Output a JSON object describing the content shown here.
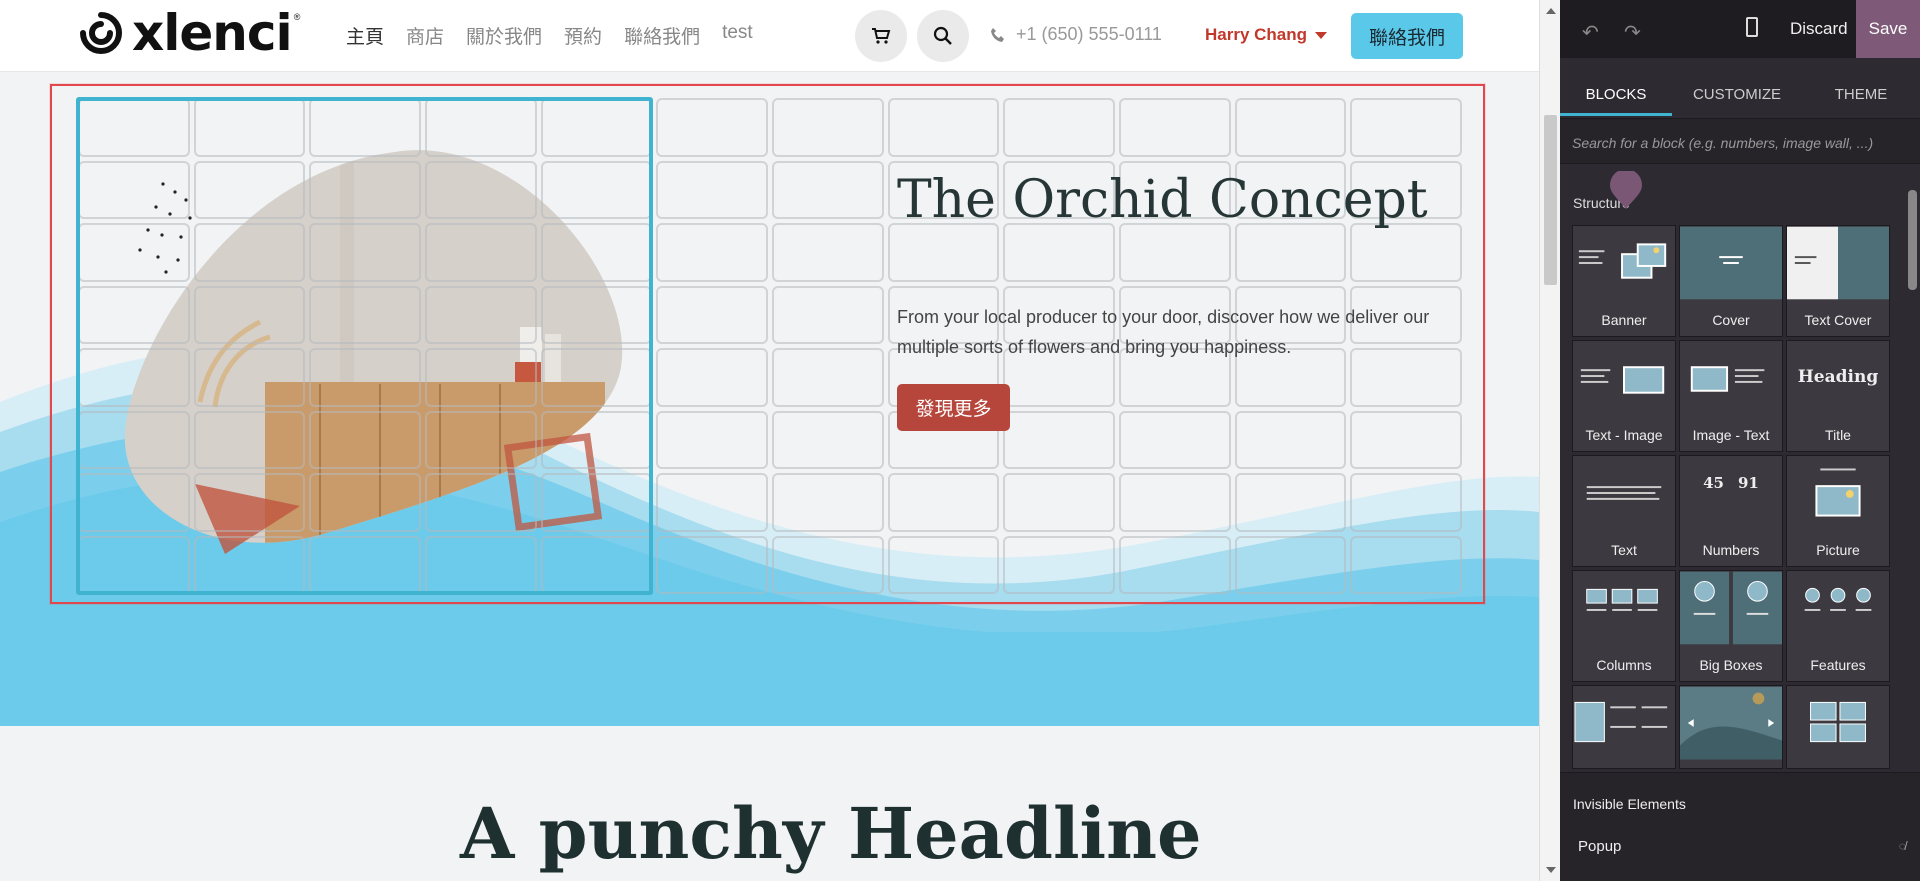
{
  "header": {
    "logo_text": "xlenci",
    "logo_reg": "®",
    "nav": [
      "主頁",
      "商店",
      "關於我們",
      "預約",
      "聯絡我們",
      "test"
    ],
    "phone": "+1 (650) 555-0111",
    "user": "Harry Chang",
    "contact_button": "聯絡我們"
  },
  "hero": {
    "title": "The Orchid Concept",
    "text": "From your local producer to your door, discover how we deliver our multiple sorts of flowers and bring you happiness.",
    "button": "發現更多"
  },
  "next_section": {
    "headline": "A punchy Headline"
  },
  "editor": {
    "discard": "Discard",
    "save": "Save",
    "tabs": [
      "BLOCKS",
      "CUSTOMIZE",
      "THEME"
    ],
    "search_placeholder": "Search for a block (e.g. numbers, image wall, ...)",
    "section": "Structure",
    "blocks": [
      "Banner",
      "Cover",
      "Text Cover",
      "Text - Image",
      "Image - Text",
      "Title",
      "Text",
      "Numbers",
      "Picture",
      "Columns",
      "Big Boxes",
      "Features"
    ],
    "title_thumb": "Heading",
    "numbers_thumb": [
      "45",
      "91"
    ],
    "invisible_title": "Invisible Elements",
    "popup": "Popup"
  },
  "colors": {
    "accent": "#5ac8e8",
    "brand_red": "#b6463b",
    "selection": "#e0484d",
    "column": "#3fb3cf",
    "editor_bg": "#2d2a31",
    "save": "#7e5a78"
  }
}
